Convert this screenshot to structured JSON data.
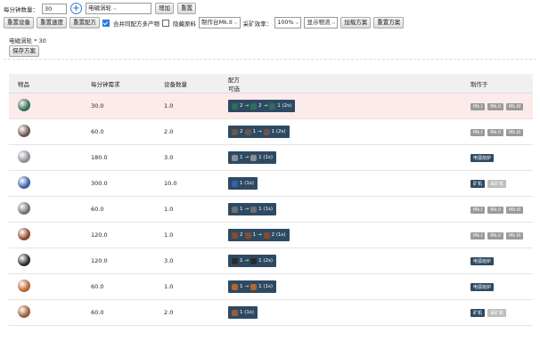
{
  "toolbar": {
    "qty_label": "每分钟数量：",
    "qty_value": "30",
    "item_select": "电磁涡轮",
    "add_label": "增加",
    "reset_label": "重置"
  },
  "options": {
    "reset_device": "重置设备",
    "reset_speed": "重置速度",
    "reset_recipe": "重置配方",
    "merge_label": "合并同配方多产物",
    "hide_raw_label": "隐藏原料",
    "maker_select": "制作台Mk.II",
    "mining_label": "采矿效率：",
    "mining_value": "100%",
    "display_select": "显示物流",
    "add_plan": "加载方案",
    "reset_plan": "重置方案"
  },
  "summary": {
    "item": "电磁涡轮",
    "count": "* 30",
    "save_label": "保存方案"
  },
  "table": {
    "headers": [
      "物品",
      "每分钟需求",
      "设备数量",
      "配方",
      "制作于"
    ],
    "recipe_sub": "可选",
    "rows": [
      {
        "icon": "turbine-icon",
        "color": "#2f6f5a",
        "rate": "30.0",
        "count": "1.0",
        "recipe": [
          "2",
          "→",
          "2",
          "→",
          "1 (2s)"
        ],
        "makers": [
          "Mk.I",
          "Mk.II",
          "Mk.III"
        ],
        "maker_style": "grey",
        "highlight": true
      },
      {
        "icon": "motor-icon",
        "color": "#6b5548",
        "rate": "60.0",
        "count": "2.0",
        "recipe": [
          "2",
          "1",
          "→",
          "1 (2s)"
        ],
        "makers": [
          "Mk.I",
          "Mk.II",
          "Mk.III"
        ],
        "maker_style": "grey",
        "highlight": false
      },
      {
        "icon": "iron-plate-icon",
        "color": "#8a8f96",
        "rate": "180.0",
        "count": "3.0",
        "recipe": [
          "1",
          "→",
          "1 (1s)"
        ],
        "makers": [
          "电弧熔炉"
        ],
        "maker_style": "dark",
        "highlight": false
      },
      {
        "icon": "iron-ore-icon",
        "color": "#3a5ea8",
        "rate": "300.0",
        "count": "10.0",
        "recipe": [
          "1 (1s)"
        ],
        "makers": [
          "矿机",
          "采矿机"
        ],
        "maker_style": "mixed",
        "highlight": false
      },
      {
        "icon": "gear-icon",
        "color": "#707070",
        "rate": "60.0",
        "count": "1.0",
        "recipe": [
          "1",
          "→",
          "1 (1s)"
        ],
        "makers": [
          "Mk.I",
          "Mk.II",
          "Mk.III"
        ],
        "maker_style": "grey",
        "highlight": false
      },
      {
        "icon": "coil-icon",
        "color": "#8a4a2a",
        "rate": "120.0",
        "count": "1.0",
        "recipe": [
          "2",
          "1",
          "→",
          "2 (1s)"
        ],
        "makers": [
          "Mk.I",
          "Mk.II",
          "Mk.III"
        ],
        "maker_style": "grey",
        "highlight": false
      },
      {
        "icon": "magnet-icon",
        "color": "#2b2b2b",
        "rate": "120.0",
        "count": "3.0",
        "recipe": [
          "1",
          "→",
          "1 (2s)"
        ],
        "makers": [
          "电弧熔炉"
        ],
        "maker_style": "dark",
        "highlight": false
      },
      {
        "icon": "copper-plate-icon",
        "color": "#b5652f",
        "rate": "60.0",
        "count": "1.0",
        "recipe": [
          "1",
          "→",
          "1 (1s)"
        ],
        "makers": [
          "电弧熔炉"
        ],
        "maker_style": "dark",
        "highlight": false
      },
      {
        "icon": "copper-ore-icon",
        "color": "#9a5a38",
        "rate": "60.0",
        "count": "2.0",
        "recipe": [
          "1 (1s)"
        ],
        "makers": [
          "矿机",
          "采矿机"
        ],
        "maker_style": "mixed",
        "highlight": false
      }
    ]
  }
}
